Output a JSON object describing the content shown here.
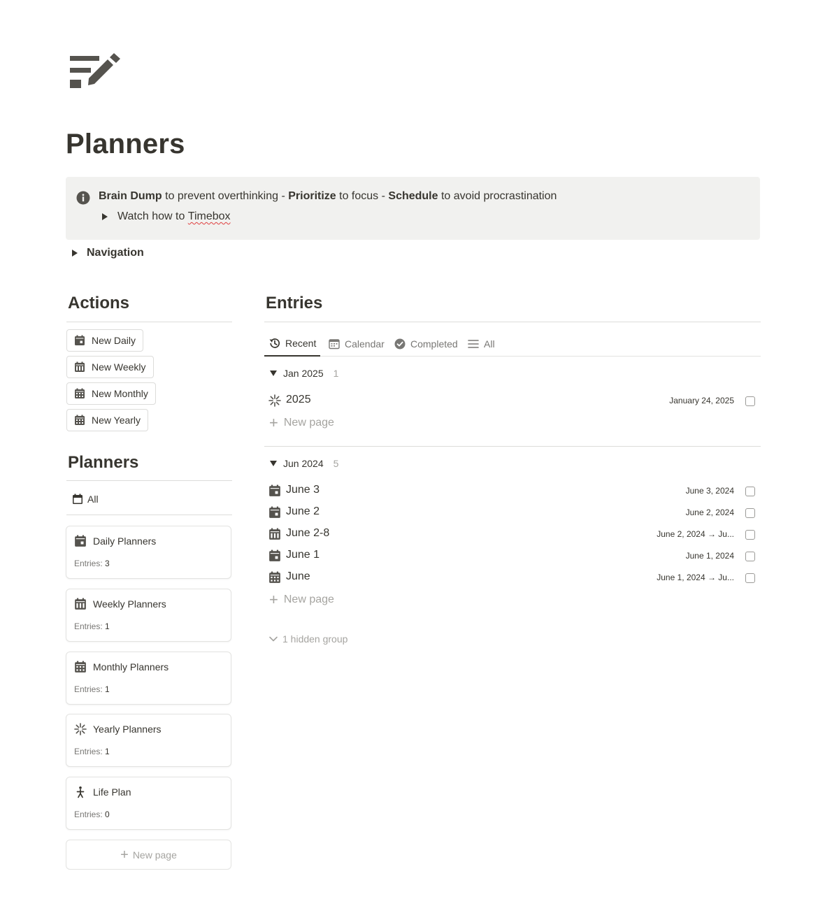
{
  "page": {
    "icon": "notes-edit-icon",
    "title": "Planners"
  },
  "callout": {
    "icon": "info-icon",
    "bold1": "Brain Dump",
    "text1": " to prevent overthinking - ",
    "bold2": "Prioritize",
    "text2": " to focus - ",
    "bold3": "Schedule",
    "text3": " to avoid procrastination",
    "toggle_prefix": "Watch how to ",
    "toggle_link": "Timebox"
  },
  "navigation_toggle": "Navigation",
  "actions": {
    "heading": "Actions",
    "buttons": [
      {
        "label": "New Daily",
        "icon": "calendar-day-icon"
      },
      {
        "label": "New Weekly",
        "icon": "calendar-week-icon"
      },
      {
        "label": "New Monthly",
        "icon": "calendar-month-icon"
      },
      {
        "label": "New Yearly",
        "icon": "calendar-month-icon"
      }
    ]
  },
  "planners": {
    "heading": "Planners",
    "view_label": "All",
    "meta_label": "Entries:",
    "cards": [
      {
        "title": "Daily Planners",
        "entries": "3",
        "icon": "calendar-day-icon"
      },
      {
        "title": "Weekly Planners",
        "entries": "1",
        "icon": "calendar-week-icon"
      },
      {
        "title": "Monthly Planners",
        "entries": "1",
        "icon": "calendar-month-icon"
      },
      {
        "title": "Yearly Planners",
        "entries": "1",
        "icon": "sparkle-icon"
      },
      {
        "title": "Life Plan",
        "entries": "0",
        "icon": "person-walking-icon"
      }
    ],
    "new_page": "New page"
  },
  "entries": {
    "heading": "Entries",
    "tabs": [
      {
        "label": "Recent",
        "icon": "history-icon",
        "active": true
      },
      {
        "label": "Calendar",
        "icon": "calendar-icon",
        "active": false
      },
      {
        "label": "Completed",
        "icon": "check-circle-icon",
        "active": false
      },
      {
        "label": "All",
        "icon": "list-icon",
        "active": false
      }
    ],
    "groups": [
      {
        "label": "Jan 2025",
        "count": "1",
        "rows": [
          {
            "title": "2025",
            "date": "January 24, 2025",
            "icon": "sparkle-icon",
            "done": false
          }
        ]
      },
      {
        "label": "Jun 2024",
        "count": "5",
        "rows": [
          {
            "title": "June 3",
            "date": "June 3, 2024",
            "icon": "calendar-day-icon",
            "done": false
          },
          {
            "title": "June 2",
            "date": "June 2, 2024",
            "icon": "calendar-day-icon",
            "done": false
          },
          {
            "title": "June 2-8",
            "date": "June 2, 2024 → Ju...",
            "icon": "calendar-week-icon",
            "done": false
          },
          {
            "title": "June 1",
            "date": "June 1, 2024",
            "icon": "calendar-day-icon",
            "done": false
          },
          {
            "title": "June",
            "date": "June 1, 2024 → Ju...",
            "icon": "calendar-month-icon",
            "done": false
          }
        ]
      }
    ],
    "new_page": "New page",
    "hidden_groups": "1 hidden group"
  },
  "colors": {
    "text": "#37352f",
    "muted": "#787774",
    "faint": "#a5a4a0",
    "callout_bg": "#f1f1ef",
    "border": "#e3e3e1"
  }
}
